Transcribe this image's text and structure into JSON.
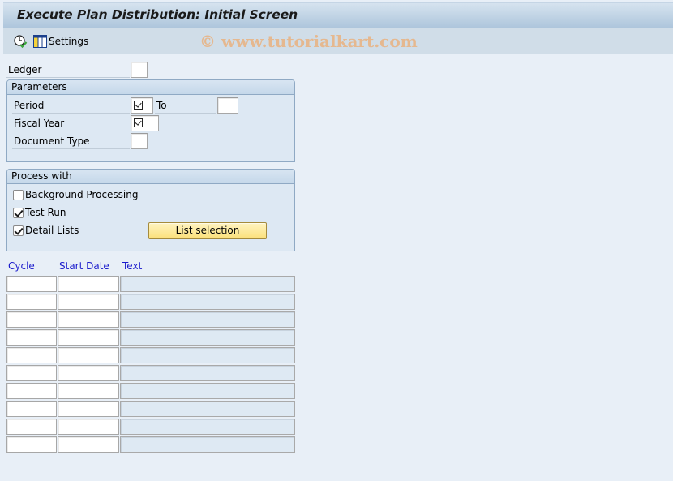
{
  "window": {
    "title": "Execute Plan Distribution: Initial Screen"
  },
  "toolbar": {
    "execute_icon": "execute-clock-icon",
    "settings_icon": "layout-settings-icon",
    "settings_label": "Settings",
    "watermark": "© www.tutorialkart.com"
  },
  "form": {
    "ledger": {
      "label": "Ledger",
      "value": ""
    },
    "parameters": {
      "title": "Parameters",
      "period": {
        "label": "Period",
        "value": "",
        "required": true,
        "to_label": "To",
        "to_value": ""
      },
      "fiscal_year": {
        "label": "Fiscal Year",
        "value": "",
        "required": true
      },
      "document_type": {
        "label": "Document Type",
        "value": ""
      }
    },
    "process_with": {
      "title": "Process with",
      "background_processing": {
        "label": "Background Processing",
        "checked": false
      },
      "test_run": {
        "label": "Test Run",
        "checked": true
      },
      "detail_lists": {
        "label": "Detail Lists",
        "checked": true
      },
      "list_selection_button": "List selection"
    }
  },
  "cycle_table": {
    "columns": [
      "Cycle",
      "Start Date",
      "Text"
    ],
    "rows": [
      {
        "cycle": "",
        "start_date": "",
        "text": ""
      },
      {
        "cycle": "",
        "start_date": "",
        "text": ""
      },
      {
        "cycle": "",
        "start_date": "",
        "text": ""
      },
      {
        "cycle": "",
        "start_date": "",
        "text": ""
      },
      {
        "cycle": "",
        "start_date": "",
        "text": ""
      },
      {
        "cycle": "",
        "start_date": "",
        "text": ""
      },
      {
        "cycle": "",
        "start_date": "",
        "text": ""
      },
      {
        "cycle": "",
        "start_date": "",
        "text": ""
      },
      {
        "cycle": "",
        "start_date": "",
        "text": ""
      },
      {
        "cycle": "",
        "start_date": "",
        "text": ""
      }
    ]
  },
  "colors": {
    "button_yellow": "#fbe07a",
    "column_header_blue": "#1a1acc",
    "background": "#e8eff7"
  }
}
